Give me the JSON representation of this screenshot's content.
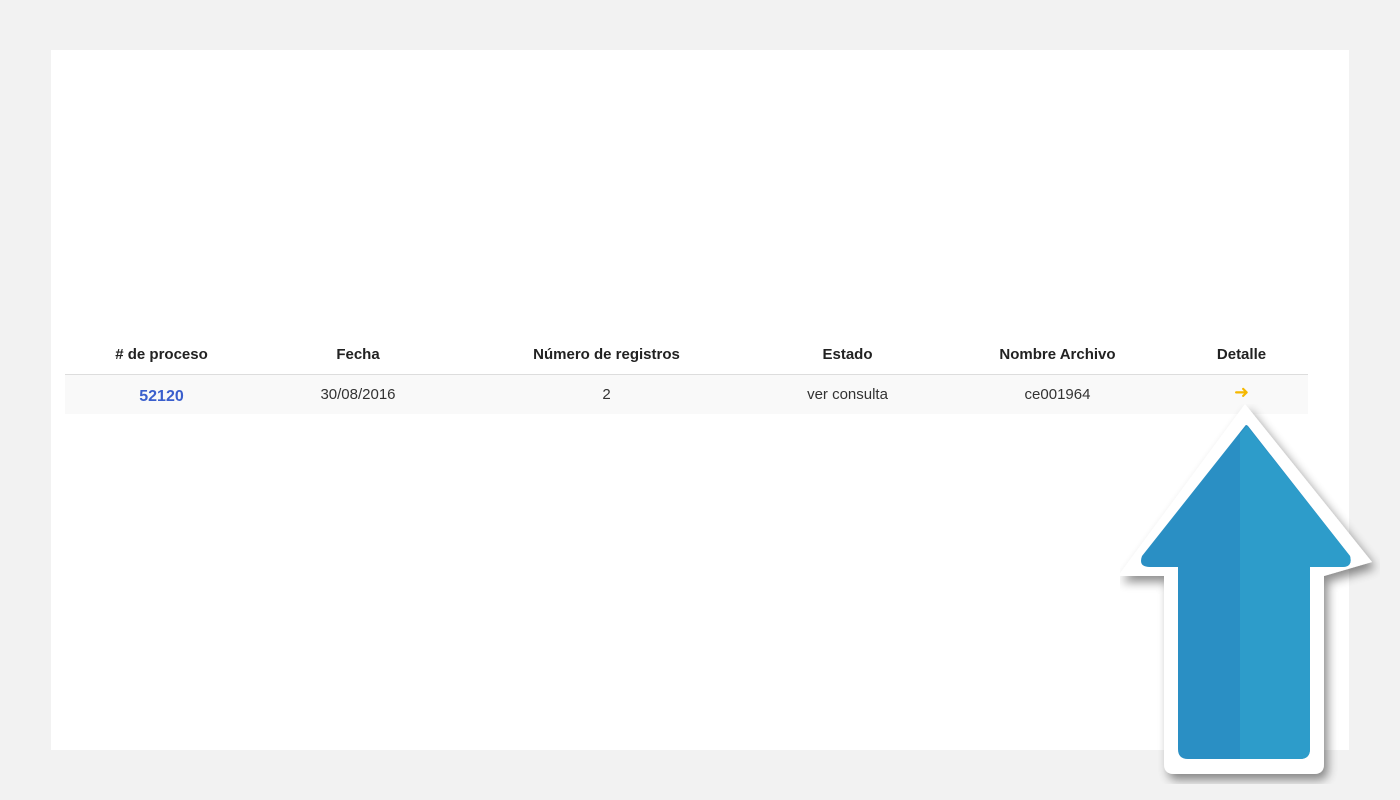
{
  "table": {
    "headers": {
      "process": "# de proceso",
      "date": "Fecha",
      "records": "Número de registros",
      "status": "Estado",
      "file": "Nombre Archivo",
      "detail": "Detalle"
    },
    "rows": [
      {
        "process": "52120",
        "date": "30/08/2016",
        "records": "2",
        "status": "ver consulta",
        "file": "ce001964",
        "detail_icon": "arrow-right-icon"
      }
    ]
  },
  "annotation": {
    "icon": "up-arrow-icon",
    "color": "#2a8fc4",
    "highlight_color": "#2e9fcb",
    "accent_color": "#f5b800",
    "link_color": "#3a5fcd"
  }
}
